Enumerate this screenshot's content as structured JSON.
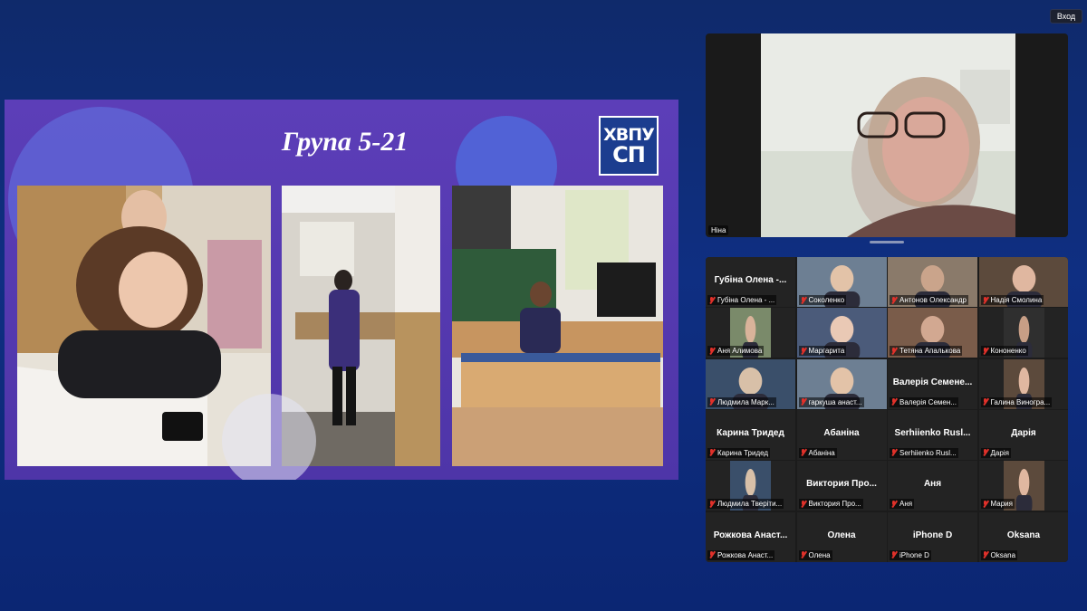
{
  "header": {
    "login_label": "Вход"
  },
  "slide": {
    "title": "Група  5-21",
    "logo_line1": "ХВПУ",
    "logo_line2": "СП",
    "accent": "#5a3fb6"
  },
  "speaker": {
    "name": "Ніна"
  },
  "gallery": {
    "tiles": [
      {
        "big": "Губіна Олена -...",
        "label": "Губіна Олена - ...",
        "video": false
      },
      {
        "big": "",
        "label": "Соколенко",
        "video": true
      },
      {
        "big": "",
        "label": "Антонов Олександр",
        "video": true
      },
      {
        "big": "",
        "label": "Надія Смолина",
        "video": true
      },
      {
        "big": "",
        "label": "Аня Алимова",
        "video": true
      },
      {
        "big": "",
        "label": "Маргарита",
        "video": true
      },
      {
        "big": "",
        "label": "Тетяна Апалькова",
        "video": true
      },
      {
        "big": "",
        "label": "Кононенко",
        "video": true
      },
      {
        "big": "",
        "label": "Людмила Марк...",
        "video": true
      },
      {
        "big": "",
        "label": "гаркуша анаст...",
        "video": true
      },
      {
        "big": "Валерія Семене...",
        "label": "Валерія Семен...",
        "video": false
      },
      {
        "big": "",
        "label": "Галина Виногра...",
        "video": true
      },
      {
        "big": "Карина Тридед",
        "label": "Карина Тридед",
        "video": false
      },
      {
        "big": "Абаніна",
        "label": "Абаніна",
        "video": false
      },
      {
        "big": "Serhiienko Rusl...",
        "label": "Serhiienko Rusl...",
        "video": false
      },
      {
        "big": "Дарія",
        "label": "Дарія",
        "video": false
      },
      {
        "big": "",
        "label": "Людмила Тверіти...",
        "video": true
      },
      {
        "big": "Виктория Про...",
        "label": "Виктория Про...",
        "video": false
      },
      {
        "big": "Аня",
        "label": "Аня",
        "video": false
      },
      {
        "big": "",
        "label": "Мария",
        "video": true
      },
      {
        "big": "Рожкова Анаст...",
        "label": "Рожкова Анаст...",
        "video": false
      },
      {
        "big": "Олена",
        "label": "Олена",
        "video": false
      },
      {
        "big": "iPhone D",
        "label": "iPhone D",
        "video": false
      },
      {
        "big": "Oksana",
        "label": "Oksana",
        "video": false
      }
    ]
  },
  "colors": {
    "muted_mic": "#e0312a",
    "background": "#0f2f82"
  }
}
